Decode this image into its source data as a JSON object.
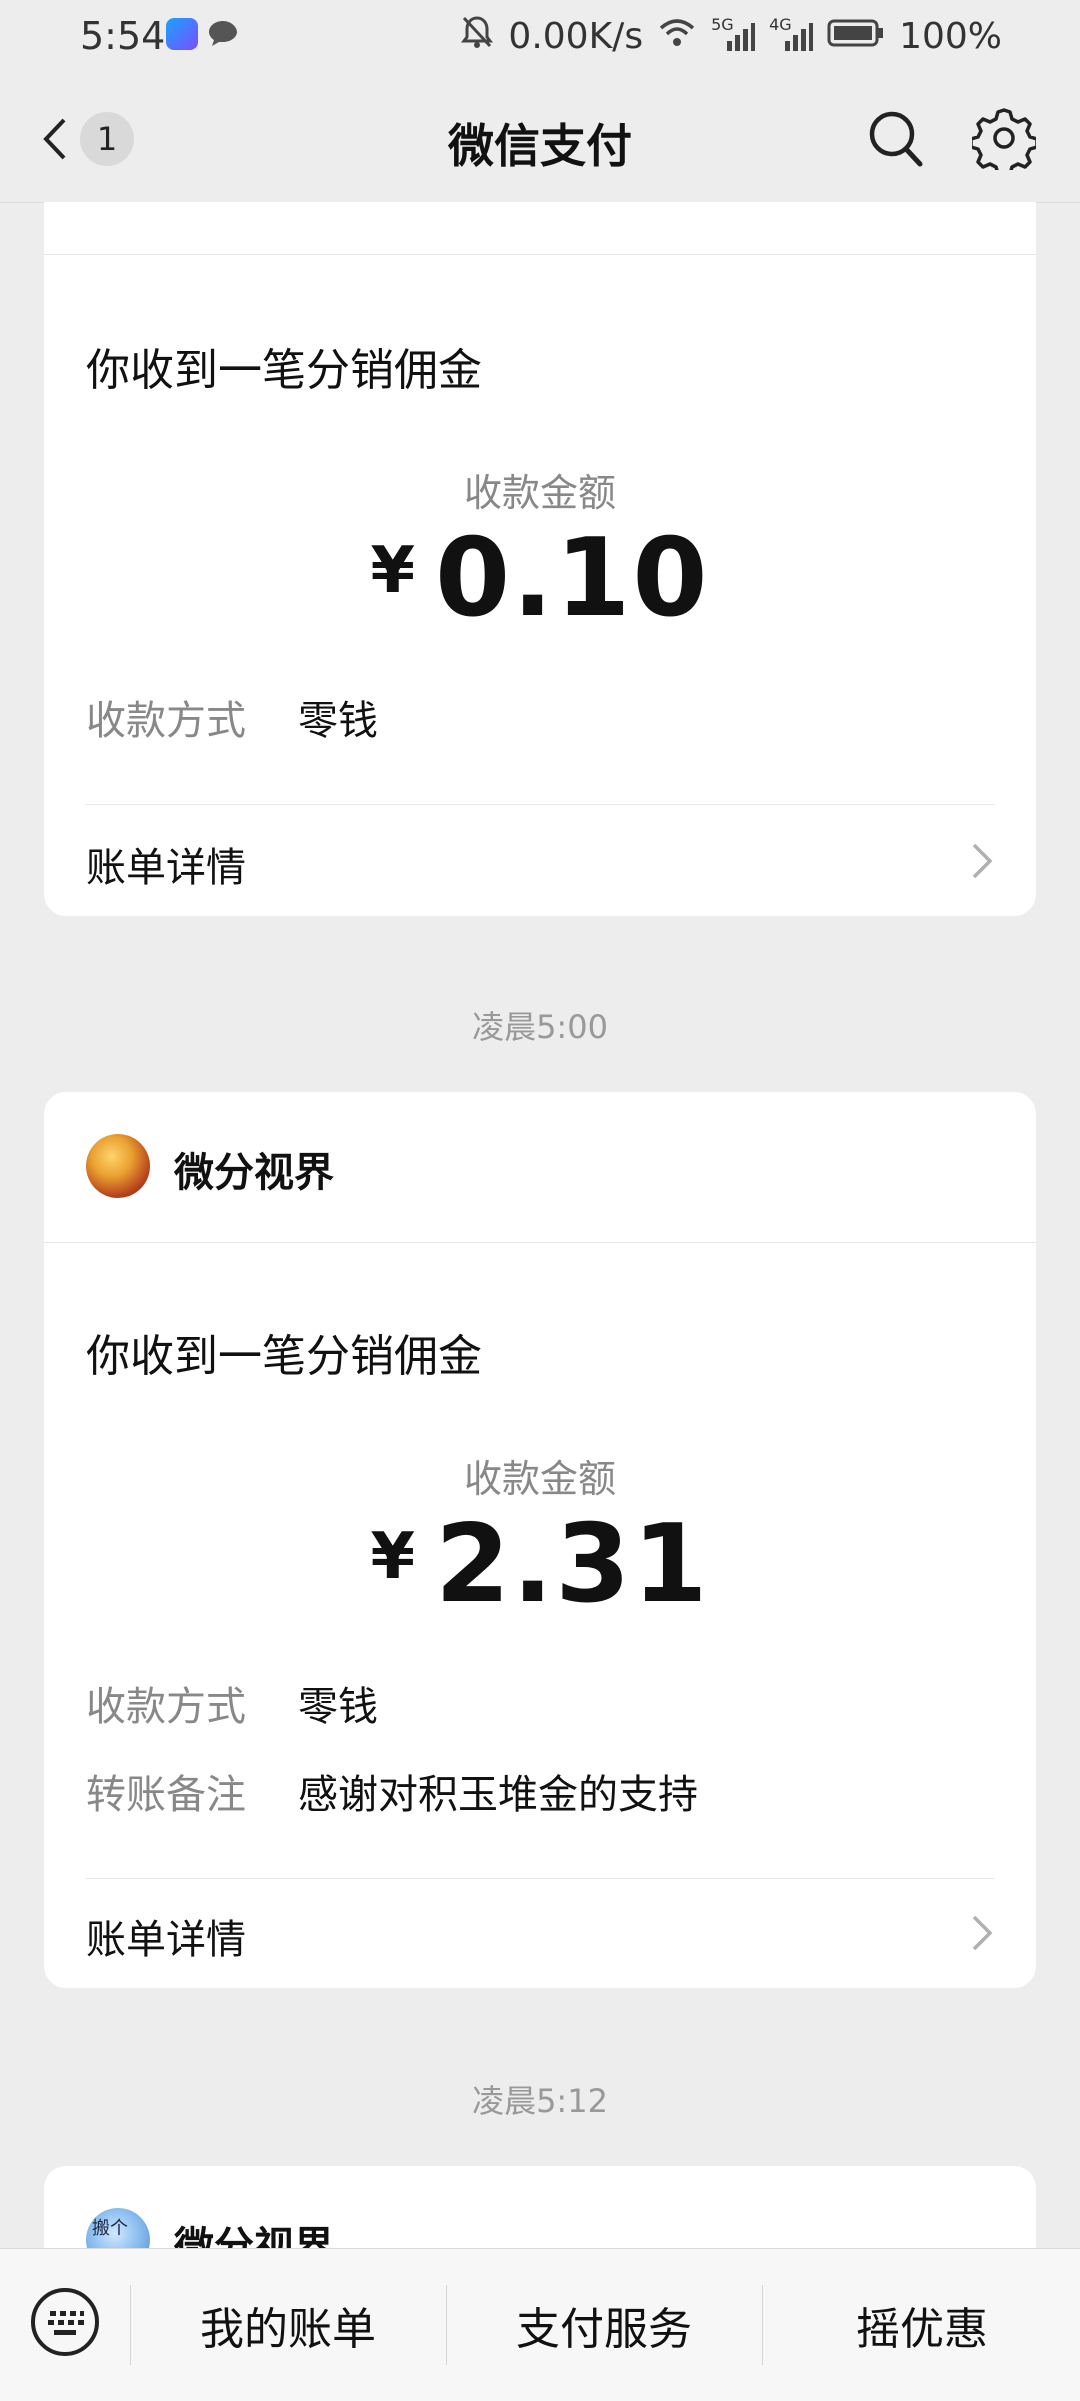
{
  "status_bar": {
    "time": "5:54",
    "speed": "0.00K/s",
    "network1": "5G",
    "network2": "4G",
    "battery": "100%"
  },
  "nav": {
    "back_count": "1",
    "title": "微信支付"
  },
  "cards": [
    {
      "title": "你收到一笔分销佣金",
      "amount_label": "收款金额",
      "currency": "¥",
      "amount": "0.10",
      "method_label": "收款方式",
      "method_value": "零钱",
      "detail_label": "账单详情"
    },
    {
      "sender": "微分视界",
      "title": "你收到一笔分销佣金",
      "amount_label": "收款金额",
      "currency": "¥",
      "amount": "2.31",
      "method_label": "收款方式",
      "method_value": "零钱",
      "note_label": "转账备注",
      "note_value": "感谢对积玉堆金的支持",
      "detail_label": "账单详情"
    },
    {
      "sender": "微分视界",
      "avatar_text": "搬个"
    }
  ],
  "timestamps": [
    "凌晨5:00",
    "凌晨5:12"
  ],
  "tabbar": {
    "tab1": "我的账单",
    "tab2": "支付服务",
    "tab3": "摇优惠"
  }
}
